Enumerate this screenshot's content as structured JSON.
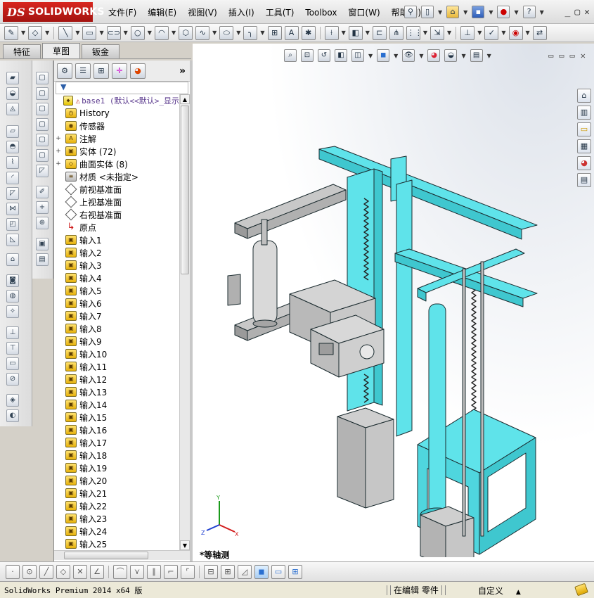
{
  "app": {
    "logo_prefix": "DS",
    "logo_text": "SOLIDWORKS"
  },
  "menu": [
    "文件(F)",
    "编辑(E)",
    "视图(V)",
    "插入(I)",
    "工具(T)",
    "Toolbox",
    "窗口(W)",
    "帮助(H)"
  ],
  "title_tools": [
    "pin-icon",
    "new-document-icon",
    "open-icon",
    "save-icon",
    "rebuild-traffic-light-icon",
    "help-icon"
  ],
  "window_controls": [
    "_",
    "▢",
    "✕"
  ],
  "command_tabs": [
    {
      "label": "特征",
      "active": false
    },
    {
      "label": "草图",
      "active": true
    },
    {
      "label": "钣金",
      "active": false
    }
  ],
  "feature_tree": {
    "expand_symbol": "»",
    "filter_icon": "▼",
    "root": {
      "warning": "⚠",
      "label": "base1 (默认<<默认>_显示"
    },
    "items": [
      {
        "expand": "",
        "icon": "history",
        "label": "History"
      },
      {
        "expand": "",
        "icon": "sensor",
        "label": "传感器"
      },
      {
        "expand": "+",
        "icon": "annotation",
        "label": "注解"
      },
      {
        "expand": "+",
        "icon": "solid-bodies",
        "label": "实体 (72)"
      },
      {
        "expand": "+",
        "icon": "surface-bodies",
        "label": "曲面实体 (8)"
      },
      {
        "expand": "",
        "icon": "material",
        "label": "材质 <未指定>"
      },
      {
        "expand": "",
        "icon": "plane",
        "label": "前视基准面"
      },
      {
        "expand": "",
        "icon": "plane",
        "label": "上视基准面"
      },
      {
        "expand": "",
        "icon": "plane",
        "label": "右视基准面"
      },
      {
        "expand": "",
        "icon": "origin",
        "label": "原点"
      },
      {
        "expand": "",
        "icon": "import",
        "label": "输入1"
      },
      {
        "expand": "",
        "icon": "import",
        "label": "输入2"
      },
      {
        "expand": "",
        "icon": "import",
        "label": "输入3"
      },
      {
        "expand": "",
        "icon": "import",
        "label": "输入4"
      },
      {
        "expand": "",
        "icon": "import",
        "label": "输入5"
      },
      {
        "expand": "",
        "icon": "import",
        "label": "输入6"
      },
      {
        "expand": "",
        "icon": "import",
        "label": "输入7"
      },
      {
        "expand": "",
        "icon": "import",
        "label": "输入8"
      },
      {
        "expand": "",
        "icon": "import",
        "label": "输入9"
      },
      {
        "expand": "",
        "icon": "import",
        "label": "输入10"
      },
      {
        "expand": "",
        "icon": "import",
        "label": "输入11"
      },
      {
        "expand": "",
        "icon": "import",
        "label": "输入12"
      },
      {
        "expand": "",
        "icon": "import",
        "label": "输入13"
      },
      {
        "expand": "",
        "icon": "import",
        "label": "输入14"
      },
      {
        "expand": "",
        "icon": "import",
        "label": "输入15"
      },
      {
        "expand": "",
        "icon": "import",
        "label": "输入16"
      },
      {
        "expand": "",
        "icon": "import",
        "label": "输入17"
      },
      {
        "expand": "",
        "icon": "import",
        "label": "输入18"
      },
      {
        "expand": "",
        "icon": "import",
        "label": "输入19"
      },
      {
        "expand": "",
        "icon": "import",
        "label": "输入20"
      },
      {
        "expand": "",
        "icon": "import",
        "label": "输入21"
      },
      {
        "expand": "",
        "icon": "import",
        "label": "输入22"
      },
      {
        "expand": "",
        "icon": "import",
        "label": "输入23"
      },
      {
        "expand": "",
        "icon": "import",
        "label": "输入24"
      },
      {
        "expand": "",
        "icon": "import",
        "label": "输入25"
      }
    ]
  },
  "viewport": {
    "view_label": "*等轴测",
    "triad": {
      "x": "X",
      "y": "Y",
      "z": "Z"
    },
    "controls": [
      "▭",
      "▭",
      "▭",
      "✕"
    ]
  },
  "status": {
    "app_version": "SolidWorks Premium 2014 x64 版",
    "mode": "在编辑 零件",
    "units": "自定义",
    "units_caret": "▲"
  },
  "colors": {
    "frame_cyan": "#5fe3ea",
    "frame_edge": "#1a2a2e",
    "grey_part": "#b9b9b9",
    "logo_red": "#c41e1a"
  }
}
